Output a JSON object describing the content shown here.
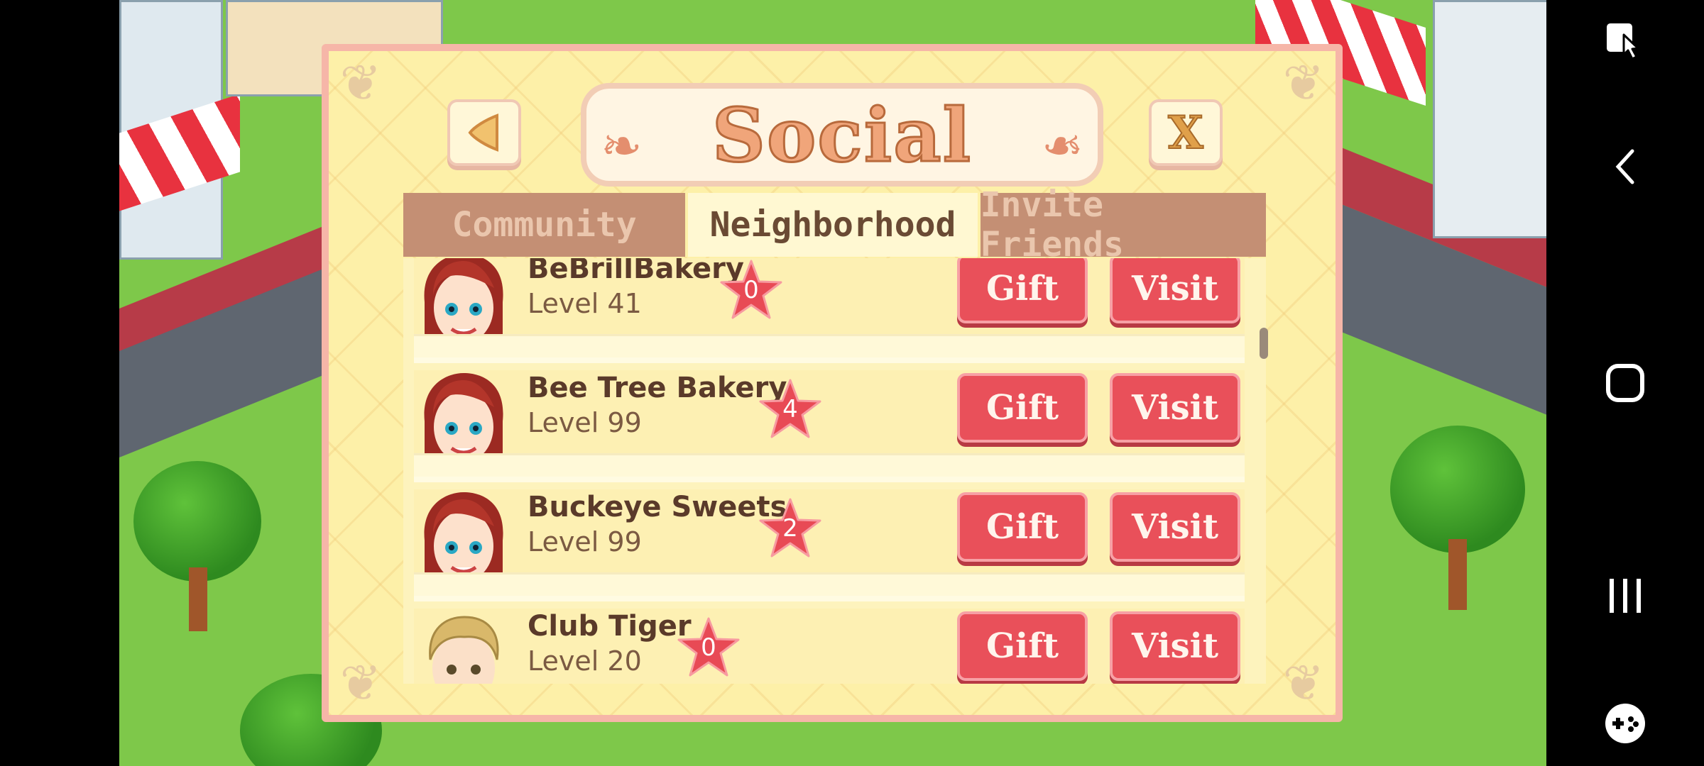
{
  "dialog": {
    "title": "Social",
    "back_icon": "triangle-left-icon",
    "close_label": "X",
    "tabs": [
      {
        "label": "Community",
        "active": false
      },
      {
        "label": "Neighborhood",
        "active": true
      },
      {
        "label": "Invite Friends",
        "active": false
      }
    ],
    "rows": [
      {
        "name": "BeBrillBakery",
        "level": "Level 41",
        "stars": "0",
        "avatar": "redhead-woman-avatar",
        "gift": "Gift",
        "visit": "Visit"
      },
      {
        "name": "Bee Tree Bakery",
        "level": "Level 99",
        "stars": "4",
        "avatar": "redhead-woman-avatar",
        "gift": "Gift",
        "visit": "Visit"
      },
      {
        "name": "Buckeye Sweets",
        "level": "Level 99",
        "stars": "2",
        "avatar": "redhead-woman-avatar",
        "gift": "Gift",
        "visit": "Visit"
      },
      {
        "name": "Club Tiger",
        "level": "Level 20",
        "stars": "0",
        "avatar": "blond-man-avatar",
        "gift": "Gift",
        "visit": "Visit"
      }
    ]
  },
  "navbar": {
    "icons": [
      "screen-capture-icon",
      "back-chevron-icon",
      "home-square-icon",
      "recents-icon",
      "game-tools-icon"
    ]
  },
  "colors": {
    "button_red": "#e9505a",
    "dialog_bg": "#fdf0a8",
    "tab_inactive": "#c48f74",
    "star_red": "#e84a55"
  }
}
